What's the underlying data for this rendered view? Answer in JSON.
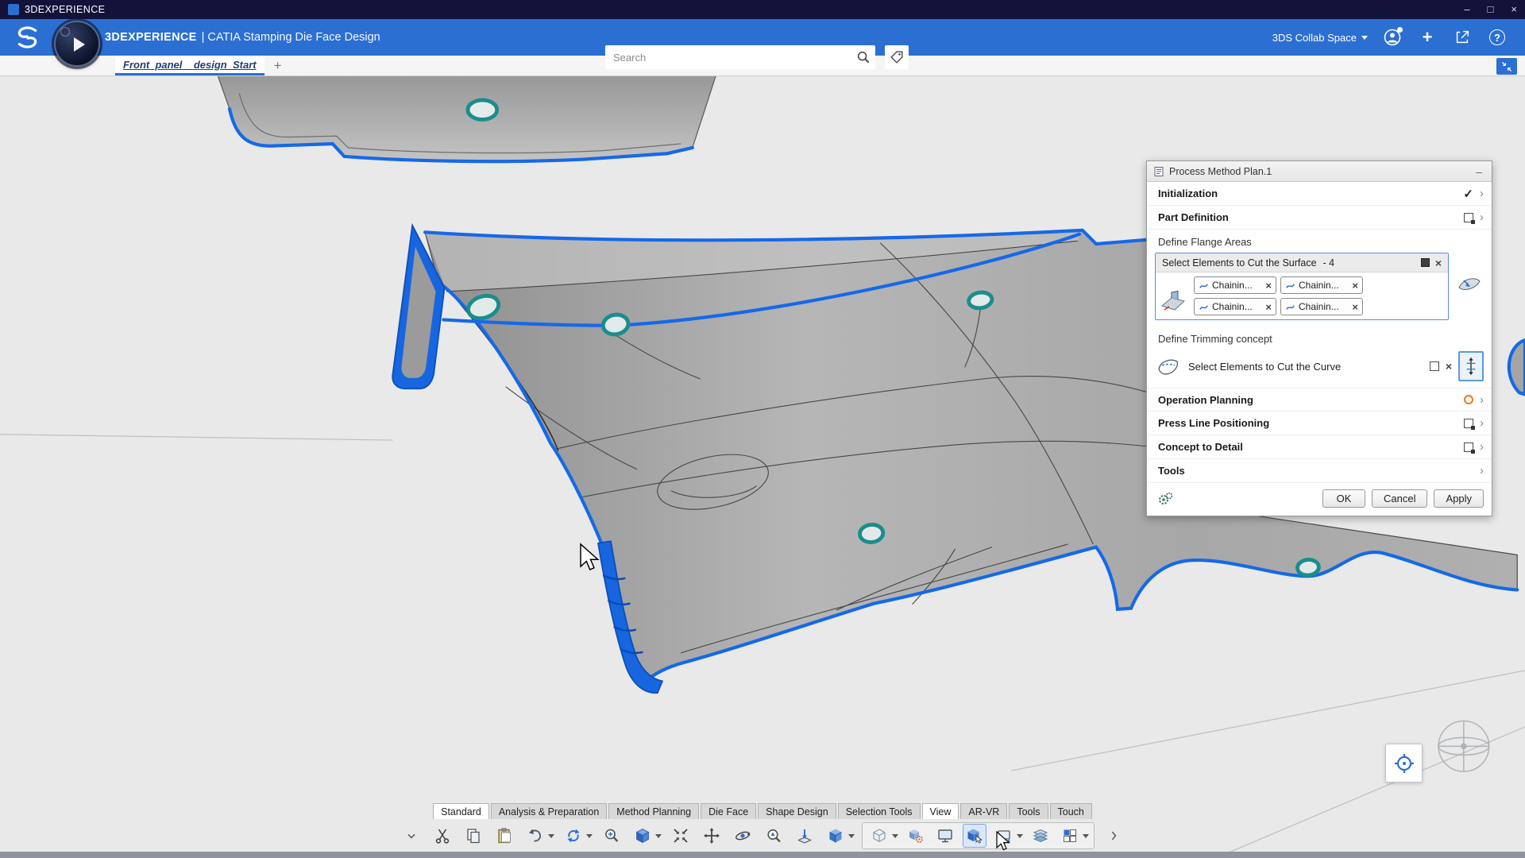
{
  "titlebar": {
    "title": "3DEXPERIENCE",
    "min": "–",
    "max": "□",
    "close": "×"
  },
  "header": {
    "brand": "3DEXPERIENCE",
    "app": "| CATIA Stamping Die Face Design",
    "search_placeholder": "Search",
    "collab_space": "3DS Collab Space"
  },
  "doc_tabs": {
    "active": "Front_panel__design_Start",
    "add": "+"
  },
  "ui": {
    "check": "✓",
    "chevron": "›",
    "close": "×",
    "minimize": "–",
    "help": "?",
    "plus": "+"
  },
  "panel": {
    "title": "Process Method Plan.1",
    "rows": {
      "initialization": "Initialization",
      "part_definition": "Part Definition",
      "define_flange_areas": "Define Flange Areas",
      "select_surface": "Select Elements to Cut the Surface",
      "surface_count": "- 4",
      "define_trimming": "Define Trimming concept",
      "select_curve": "Select Elements to Cut the Curve",
      "operation_planning": "Operation Planning",
      "press_line": "Press Line Positioning",
      "concept_to_detail": "Concept to Detail",
      "tools": "Tools"
    },
    "chips": [
      "Chainin...",
      "Chainin...",
      "Chainin...",
      "Chainin..."
    ],
    "buttons": {
      "ok": "OK",
      "cancel": "Cancel",
      "apply": "Apply"
    }
  },
  "workbench_tabs": [
    "Standard",
    "Analysis & Preparation",
    "Method Planning",
    "Die Face",
    "Shape Design",
    "Selection Tools",
    "View",
    "AR-VR",
    "Tools",
    "Touch"
  ],
  "colors": {
    "accent": "#2b6fd3",
    "edge_highlight": "#1569e8",
    "hole_ring": "#1c8c8c",
    "status_orange": "#e87a1e"
  }
}
